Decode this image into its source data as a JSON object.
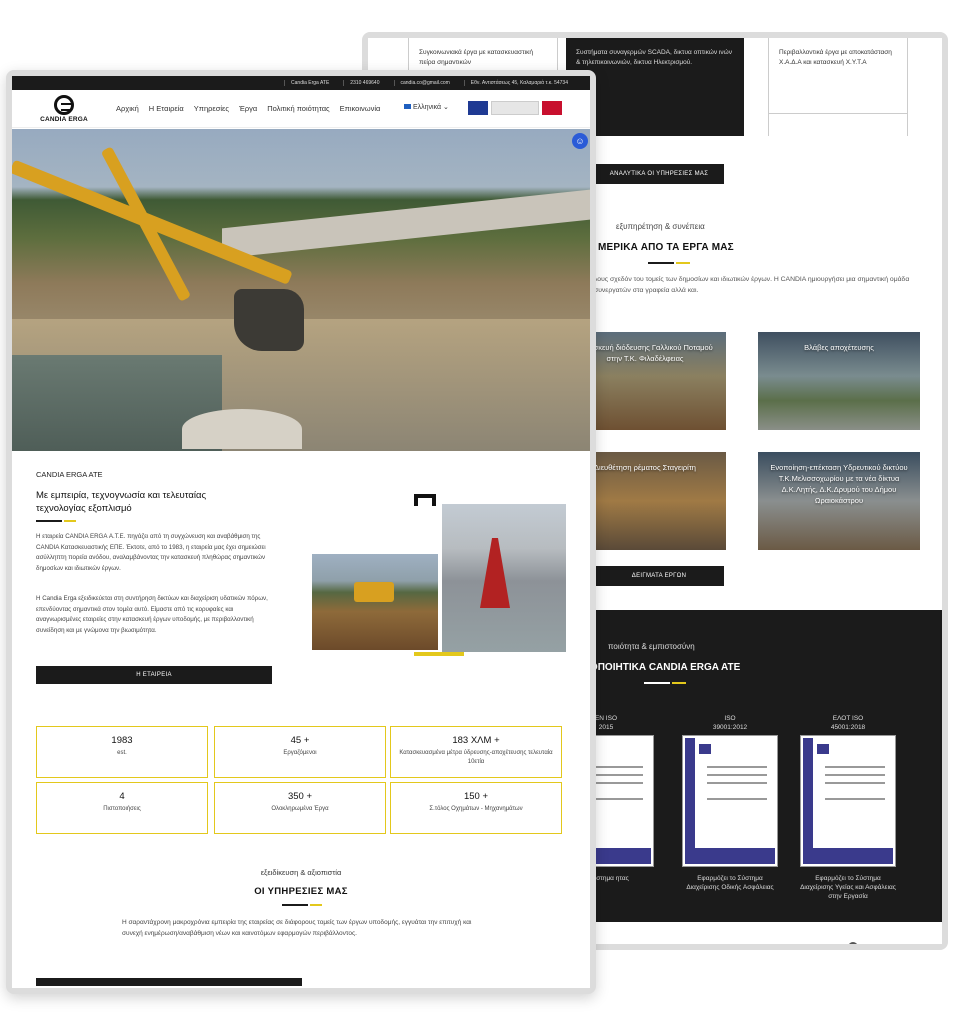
{
  "back": {
    "services_strip": [
      "Συγκοινωνιακά έργα με κατασκευαστική πείρα σημαντικών",
      "Συστήματα συναγερμών SCADA, δικτυα οπτικών ινών & τηλεπικοινωνιών, δικτυα Ηλεκτρισμού.",
      "Περιβαλλοντικά έργα με αποκατάσταση Χ.Α.Δ.Α και κατασκευή Χ.Υ.Τ.Α"
    ],
    "services_button": "ΑΝΑΛΥΤΙΚΑ ΟΙ ΥΠΗΡΕΣΙΕΣ ΜΑΣ",
    "projects_kicker": "εξυπηρέτηση & συνέπεια",
    "projects_title": "ΜΕΡΙΚΑ ΑΠΟ ΤΑ ΕΡΓΑ ΜΑΣ",
    "projects_text": "λους σχεδόν του τομείς των δημοσίων και ιδιωτικών έργων. Η CANDIA ημιουργήσει μια σημαντική ομάδα συνεργατών στα γραφεία αλλά και.",
    "projects": [
      "Κατασκευή διόδευσης Γαλλικού Ποταμού στην Τ.Κ. Φιλαδέλφειας",
      "Βλάβες αποχέτευσης",
      "Διευθέτηση ρέματος Σταγειρίτη",
      "Ενοποίηση-επέκταση Υδρευτικού δικτύου Τ.Κ.Μελισσοχωρίου με τα νέα δίκτυα Δ.Κ.Λητής, Δ.Κ.Δρυμού του Δήμου Ωραιοκάστρου"
    ],
    "samples_button": "ΔΕΙΓΜΑΤΑ ΕΡΓΩΝ",
    "certs_kicker": "ποιότητα & εμπιστοσύνη",
    "certs_title": "ΤΟΠΟΙΗΤΙΚΑ CANDIA ERGA ATE",
    "certs": [
      {
        "top": "EN ISO",
        "sub": "2015",
        "desc": "ο Σύστημα ητας"
      },
      {
        "top": "ISO",
        "sub": "39001:2012",
        "desc": "Εφαρμόζει το Σύστημα Διαχείρισης Οδικής Ασφάλειας"
      },
      {
        "top": "ΕΛΟΤ ISO",
        "sub": "45001:2018",
        "desc": "Εφαρμόζει το Σύστημα Διαχείρισης Υγείας και Ασφάλειας στην Εργασία"
      }
    ]
  },
  "front": {
    "topbar": [
      "Candia Erga ATE",
      "2310 469640",
      "candia.co@gmail.com",
      "Εθν. Αντιστάσεως 45, Καλαμαριά τ.κ. 54734"
    ],
    "logo_text": "CANDIA ERGA",
    "menu": [
      "Αρχική",
      "Η Εταιρεία",
      "Υπηρεσίες",
      "Έργα",
      "Πολιτική ποιότητας",
      "Επικοινωνία"
    ],
    "language": "Ελληνικά",
    "accessibility_icon": "☺",
    "kicker": "CANDIA ERGA ATE",
    "headline": "Με εμπειρία, τεχνογνωσία και τελευταίας τεχνολογίας εξοπλισμό",
    "paragraph1": "Η εταιρεία CANDIA ERGA Α.Τ.Ε. πηγάζει από τη συγχώνευση και αναβάθμιση της CANDIA Κατασκευαστικής ΕΠΕ. Έκτοτε, από το 1983, η εταιρεία μας έχει σημειώσει ασύλληπτη πορεία ανόδου, αναλαμβάνοντας την κατασκευή πληθώρας σημαντικών δημοσίων και ιδιωτικών έργων.",
    "paragraph2": "Η Candia Erga εξειδικεύεται στη συντήρηση δικτύων και διαχείριση υδατικών πόρων, επενδύοντας σημαντικά στον τομέα αυτό. Είμαστε από τις κορυφαίες και αναγνωρισμένες εταιρείες στην κατασκευή έργων υποδομής, με περιβαλλοντική συνείδηση και με γνώμονα την βιωσιμότητα.",
    "company_button": "Η ΕΤΑΙΡΕΙΑ",
    "stats": [
      {
        "value": "1983",
        "label": "est."
      },
      {
        "value": "45 +",
        "label": "Εργαζόμενοι"
      },
      {
        "value": "183 ΧΛΜ +",
        "label": "Κατασκευασμένα μέτρα ύδρευσης-αποχέτευσης τελευταία 10ετία"
      },
      {
        "value": "4",
        "label": "Πιστοποιήσεις"
      },
      {
        "value": "350 +",
        "label": "Ολοκληρωμένα Έργα"
      },
      {
        "value": "150 +",
        "label": "Σ.τόλος Οχημάτων - Μηχανημάτων"
      }
    ],
    "services_kicker": "εξειδίκευση & αξιοπιστία",
    "services_title": "ΟΙ ΥΠΗΡΕΣΙΕΣ ΜΑΣ",
    "services_text": "Η σαραντάχρονη μακροχρόνια εμπειρία της εταιρείας σε διάφορους τομείς των έργων υποδομής, εγγυάται την επιτυχή και συνεχή ενημέρωση/αναβάθμιση νέων και καινοτόμων εφαρμογών περιβάλλοντος."
  },
  "colors": {
    "dark": "#1b1b1b",
    "accent": "#e3c81c",
    "access": "#2a5bd7"
  }
}
